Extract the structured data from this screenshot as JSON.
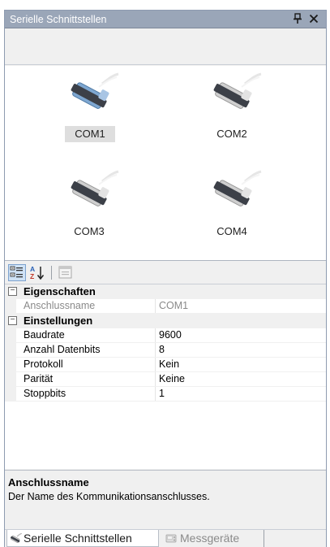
{
  "panel": {
    "title": "Serielle Schnittstellen",
    "pin_glyph": "p",
    "close_glyph": "✕"
  },
  "ports": [
    {
      "label": "COM1",
      "selected": true,
      "color": "#8fb6dc"
    },
    {
      "label": "COM2",
      "selected": false,
      "color": "#d4d4d4"
    },
    {
      "label": "COM3",
      "selected": false,
      "color": "#d4d4d4"
    },
    {
      "label": "COM4",
      "selected": false,
      "color": "#d4d4d4"
    }
  ],
  "propertygrid": {
    "toolbar": {
      "categorized_icon": "categorized-view-icon",
      "alphabetical_icon": "sort-az-icon",
      "pages_icon": "property-pages-icon"
    },
    "categories": [
      {
        "name": "Eigenschaften",
        "expanded": true,
        "properties": [
          {
            "name": "Anschlussname",
            "value": "COM1",
            "readonly": true
          }
        ]
      },
      {
        "name": "Einstellungen",
        "expanded": true,
        "properties": [
          {
            "name": "Baudrate",
            "value": "9600",
            "readonly": false
          },
          {
            "name": "Anzahl Datenbits",
            "value": "8",
            "readonly": false
          },
          {
            "name": "Protokoll",
            "value": "Kein",
            "readonly": false
          },
          {
            "name": "Parität",
            "value": "Keine",
            "readonly": false
          },
          {
            "name": "Stoppbits",
            "value": "1",
            "readonly": false
          }
        ]
      }
    ],
    "toggle_glyph": "−"
  },
  "description": {
    "title": "Anschlussname",
    "text": "Der Name des Kommunikationsanschlusses."
  },
  "tabs": [
    {
      "label": "Serielle Schnittstellen",
      "active": true,
      "icon": "serial-cable-icon"
    },
    {
      "label": "Messgeräte",
      "active": false,
      "icon": "instrument-icon"
    }
  ],
  "colors": {
    "titlebar": "#9aa6b8",
    "selected_connector": "#8fb6dc",
    "idle_connector": "#d4d4d4"
  }
}
